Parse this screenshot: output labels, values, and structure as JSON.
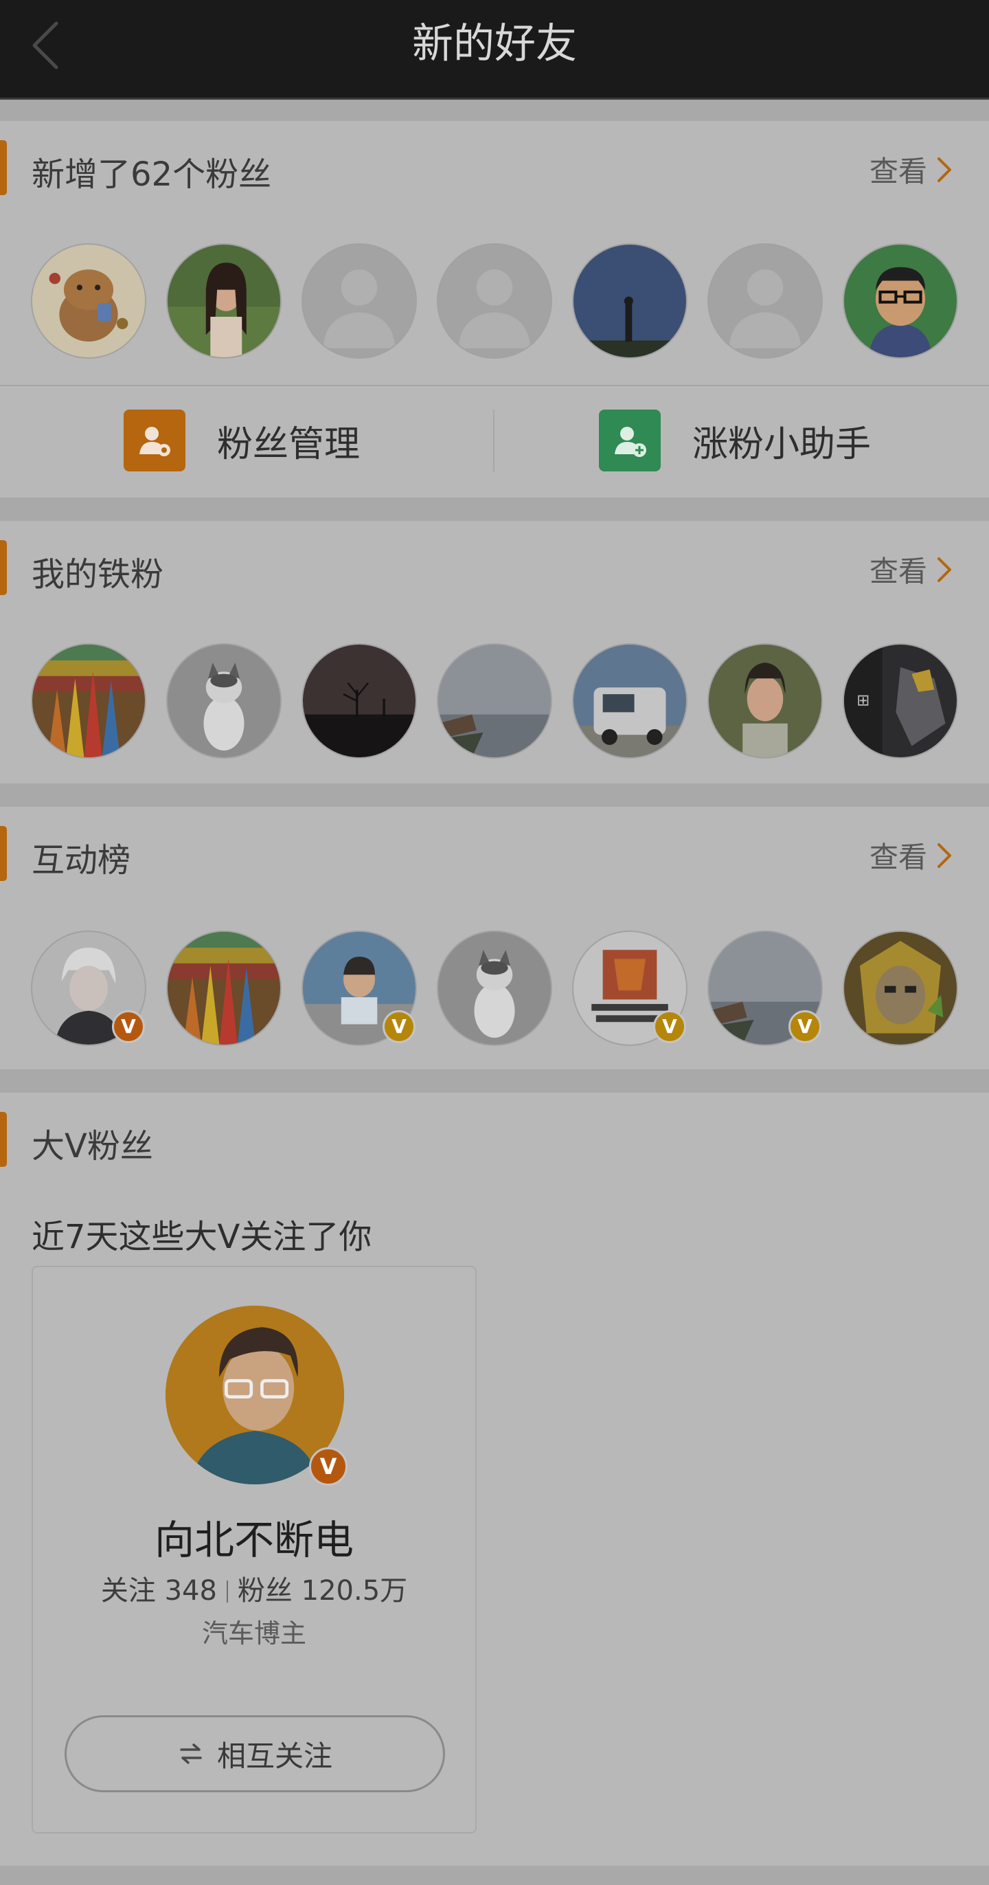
{
  "header": {
    "title": "新的好友",
    "back_icon": "chevron-left-icon"
  },
  "new_fans": {
    "title": "新增了62个粉丝",
    "see_more": "查看"
  },
  "tools": {
    "fan_manage": "粉丝管理",
    "fan_helper": "涨粉小助手"
  },
  "iron_fans": {
    "title": "我的铁粉",
    "see_more": "查看"
  },
  "interaction": {
    "title": "互动榜",
    "see_more": "查看"
  },
  "bigv": {
    "title": "大V粉丝",
    "subtitle": "近7天这些大V关注了你",
    "card": {
      "name": "向北不断电",
      "follow_label": "关注",
      "follow_count": "348",
      "fans_label": "粉丝",
      "fans_count": "120.5万",
      "desc": "汽车博主",
      "button": "相互关注",
      "badge": "V"
    }
  },
  "badges": {
    "v": "V"
  },
  "colors": {
    "accent": "#b5660f",
    "manage_icon": "#b5660f",
    "helper_icon": "#2f8a53",
    "vip_gold": "#b5860a",
    "vip_orange": "#b5580f"
  }
}
